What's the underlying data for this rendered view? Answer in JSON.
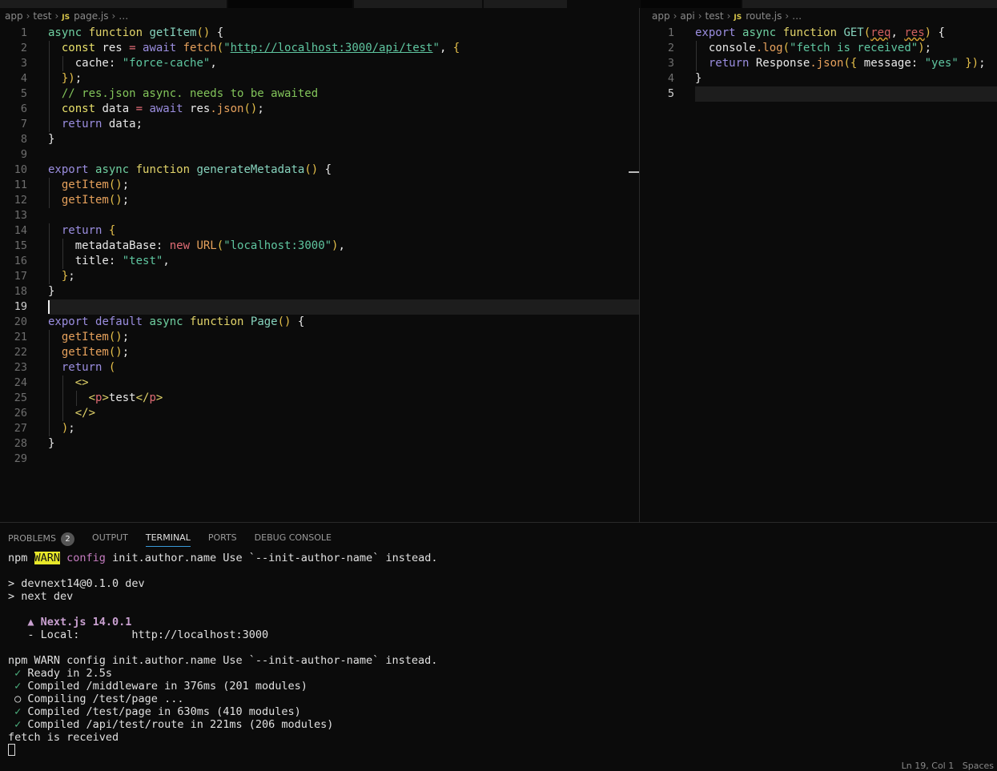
{
  "left_editor": {
    "breadcrumb": [
      "app",
      "test",
      "page.js",
      "…"
    ],
    "file_icon": "JS",
    "cursor_line": 19,
    "lines": [
      [
        [
          "async ",
          "a"
        ],
        [
          "function ",
          "f"
        ],
        [
          "getItem",
          "fn"
        ],
        [
          "() ",
          "p"
        ],
        [
          "{",
          "t"
        ]
      ],
      [
        [
          "const ",
          "cs"
        ],
        [
          "res ",
          "t"
        ],
        [
          "= ",
          "n"
        ],
        [
          "await ",
          "k"
        ],
        [
          "fetch",
          "c"
        ],
        [
          "(",
          "p"
        ],
        [
          "\"",
          "s"
        ],
        [
          "http://localhost:3000/api/test",
          "s u"
        ],
        [
          "\"",
          "s"
        ],
        [
          ", ",
          "t"
        ],
        [
          "{",
          "p"
        ]
      ],
      [
        [
          "cache: ",
          "t"
        ],
        [
          "\"force-cache\"",
          "s"
        ],
        [
          ",",
          "t"
        ]
      ],
      [
        [
          "})",
          "p"
        ],
        [
          ";",
          "t"
        ]
      ],
      [
        [
          "// res.json async. needs to be awaited",
          "cm"
        ]
      ],
      [
        [
          "const ",
          "cs"
        ],
        [
          "data ",
          "t"
        ],
        [
          "= ",
          "n"
        ],
        [
          "await ",
          "k"
        ],
        [
          "res",
          "t"
        ],
        [
          ".json",
          "c"
        ],
        [
          "()",
          "p"
        ],
        [
          ";",
          "t"
        ]
      ],
      [
        [
          "return ",
          "k"
        ],
        [
          "data;",
          "t"
        ]
      ],
      [
        [
          "}",
          "t"
        ]
      ],
      [],
      [
        [
          "export ",
          "k"
        ],
        [
          "async ",
          "a"
        ],
        [
          "function ",
          "f"
        ],
        [
          "generateMetadata",
          "fn"
        ],
        [
          "() ",
          "p"
        ],
        [
          "{",
          "t"
        ]
      ],
      [
        [
          "getItem",
          "c"
        ],
        [
          "()",
          "p"
        ],
        [
          ";",
          "t"
        ]
      ],
      [
        [
          "getItem",
          "c"
        ],
        [
          "()",
          "p"
        ],
        [
          ";",
          "t"
        ]
      ],
      [],
      [
        [
          "return ",
          "k"
        ],
        [
          "{",
          "p"
        ]
      ],
      [
        [
          "metadataBase: ",
          "t"
        ],
        [
          "new ",
          "n"
        ],
        [
          "URL",
          "c"
        ],
        [
          "(",
          "p"
        ],
        [
          "\"localhost:3000\"",
          "s"
        ],
        [
          ")",
          "p"
        ],
        [
          ",",
          "t"
        ]
      ],
      [
        [
          "title: ",
          "t"
        ],
        [
          "\"test\"",
          "s"
        ],
        [
          ",",
          "t"
        ]
      ],
      [
        [
          "}",
          "p"
        ],
        [
          ";",
          "t"
        ]
      ],
      [
        [
          "}",
          "t"
        ]
      ],
      [],
      [
        [
          "export ",
          "k"
        ],
        [
          "default ",
          "k"
        ],
        [
          "async ",
          "a"
        ],
        [
          "function ",
          "f"
        ],
        [
          "Page",
          "fn"
        ],
        [
          "() ",
          "p"
        ],
        [
          "{",
          "t"
        ]
      ],
      [
        [
          "getItem",
          "c"
        ],
        [
          "()",
          "p"
        ],
        [
          ";",
          "t"
        ]
      ],
      [
        [
          "getItem",
          "c"
        ],
        [
          "()",
          "p"
        ],
        [
          ";",
          "t"
        ]
      ],
      [
        [
          "return ",
          "k"
        ],
        [
          "(",
          "p"
        ]
      ],
      [
        [
          "<>",
          "f"
        ]
      ],
      [
        [
          "<",
          "f"
        ],
        [
          "p",
          "n"
        ],
        [
          ">",
          "f"
        ],
        [
          "test",
          "t"
        ],
        [
          "</",
          "f"
        ],
        [
          "p",
          "n"
        ],
        [
          ">",
          "f"
        ]
      ],
      [
        [
          "</>",
          "f"
        ]
      ],
      [
        [
          ")",
          "p"
        ],
        [
          ";",
          "t"
        ]
      ],
      [
        [
          "}",
          "t"
        ]
      ],
      []
    ],
    "indents": [
      0,
      1,
      2,
      1,
      1,
      1,
      1,
      0,
      0,
      0,
      1,
      1,
      0,
      1,
      2,
      2,
      1,
      0,
      0,
      0,
      1,
      1,
      1,
      2,
      3,
      2,
      1,
      0,
      0
    ]
  },
  "right_editor": {
    "breadcrumb": [
      "app",
      "api",
      "test",
      "route.js",
      "…"
    ],
    "file_icon": "JS",
    "cursor_line": 5,
    "lines": [
      [
        [
          "export ",
          "k"
        ],
        [
          "async ",
          "a"
        ],
        [
          "function ",
          "f"
        ],
        [
          "GET",
          "fn"
        ],
        [
          "(",
          "p"
        ],
        [
          "req",
          "w"
        ],
        [
          ", ",
          "t"
        ],
        [
          "res",
          "w"
        ],
        [
          ") ",
          "p"
        ],
        [
          "{",
          "t"
        ]
      ],
      [
        [
          "console",
          "t"
        ],
        [
          ".log",
          "c"
        ],
        [
          "(",
          "p"
        ],
        [
          "\"fetch is received\"",
          "s"
        ],
        [
          ")",
          "p"
        ],
        [
          ";",
          "t"
        ]
      ],
      [
        [
          "return ",
          "k"
        ],
        [
          "Response",
          "t"
        ],
        [
          ".json",
          "c"
        ],
        [
          "({ ",
          "p"
        ],
        [
          "message: ",
          "t"
        ],
        [
          "\"yes\"",
          "s"
        ],
        [
          " })",
          "p"
        ],
        [
          ";",
          "t"
        ]
      ],
      [
        [
          "}",
          "t"
        ]
      ],
      []
    ],
    "indents": [
      0,
      1,
      1,
      0,
      0
    ]
  },
  "panel": {
    "tabs": [
      "PROBLEMS",
      "OUTPUT",
      "TERMINAL",
      "PORTS",
      "DEBUG CONSOLE"
    ],
    "problems_count": "2",
    "active_tab": "TERMINAL",
    "terminal": [
      [
        [
          "npm ",
          ""
        ],
        [
          "WARN",
          "warn"
        ],
        [
          " ",
          ""
        ],
        [
          "config",
          "mag"
        ],
        [
          " init.author.name Use `--init-author-name` instead.",
          ""
        ]
      ],
      [],
      [
        [
          "> devnext14@0.1.0 dev",
          ""
        ]
      ],
      [
        [
          "> next dev",
          ""
        ]
      ],
      [],
      [
        [
          "   ",
          ""
        ],
        [
          "▲ Next.js 14.0.1",
          "next"
        ]
      ],
      [
        [
          "   - Local:        http://localhost:3000",
          ""
        ]
      ],
      [],
      [
        [
          "npm WARN config init.author.name Use `--init-author-name` instead.",
          ""
        ]
      ],
      [
        [
          " ✓",
          "ok"
        ],
        [
          " Ready in 2.5s",
          ""
        ]
      ],
      [
        [
          " ✓",
          "ok"
        ],
        [
          " Compiled /middleware in 376ms (201 modules)",
          ""
        ]
      ],
      [
        [
          " ○ Compiling /test/page ...",
          ""
        ]
      ],
      [
        [
          " ✓",
          "ok"
        ],
        [
          " Compiled /test/page in 630ms (410 modules)",
          ""
        ]
      ],
      [
        [
          " ✓",
          "ok"
        ],
        [
          " Compiled /api/test/route in 221ms (206 modules)",
          ""
        ]
      ],
      [
        [
          "fetch is received",
          ""
        ]
      ]
    ]
  },
  "status_bar": {
    "position": "Ln 19, Col 1",
    "spaces": "Spaces"
  }
}
